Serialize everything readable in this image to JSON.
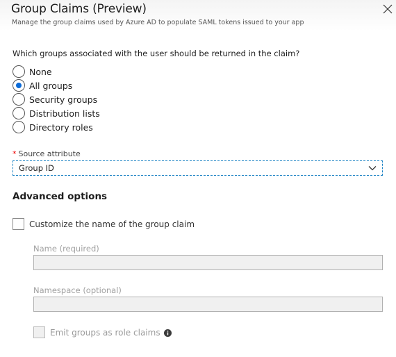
{
  "panel": {
    "title": "Group Claims (Preview)",
    "subtitle": "Manage the group claims used by Azure AD to populate SAML tokens issued to your app",
    "close_icon": "close-icon"
  },
  "groups": {
    "question": "Which groups associated with the user should be returned in the claim?",
    "options": [
      {
        "label": "None",
        "checked": false
      },
      {
        "label": "All groups",
        "checked": true
      },
      {
        "label": "Security groups",
        "checked": false
      },
      {
        "label": "Distribution lists",
        "checked": false
      },
      {
        "label": "Directory roles",
        "checked": false
      }
    ]
  },
  "source_attribute": {
    "required_marker": "*",
    "label": "Source attribute",
    "value": "Group ID"
  },
  "advanced": {
    "title": "Advanced options",
    "customize_label": "Customize the name of the group claim",
    "customize_checked": false,
    "name_label": "Name (required)",
    "name_value": "",
    "namespace_label": "Namespace (optional)",
    "namespace_value": "",
    "emit_label": "Emit groups as role claims",
    "emit_checked": false,
    "info_icon": "info-icon"
  },
  "colors": {
    "accent": "#0b6bd8",
    "focus_border": "#1b82c4",
    "required": "#e00000",
    "disabled_text": "#a0a0a0",
    "disabled_bg": "#f0f0f0"
  }
}
